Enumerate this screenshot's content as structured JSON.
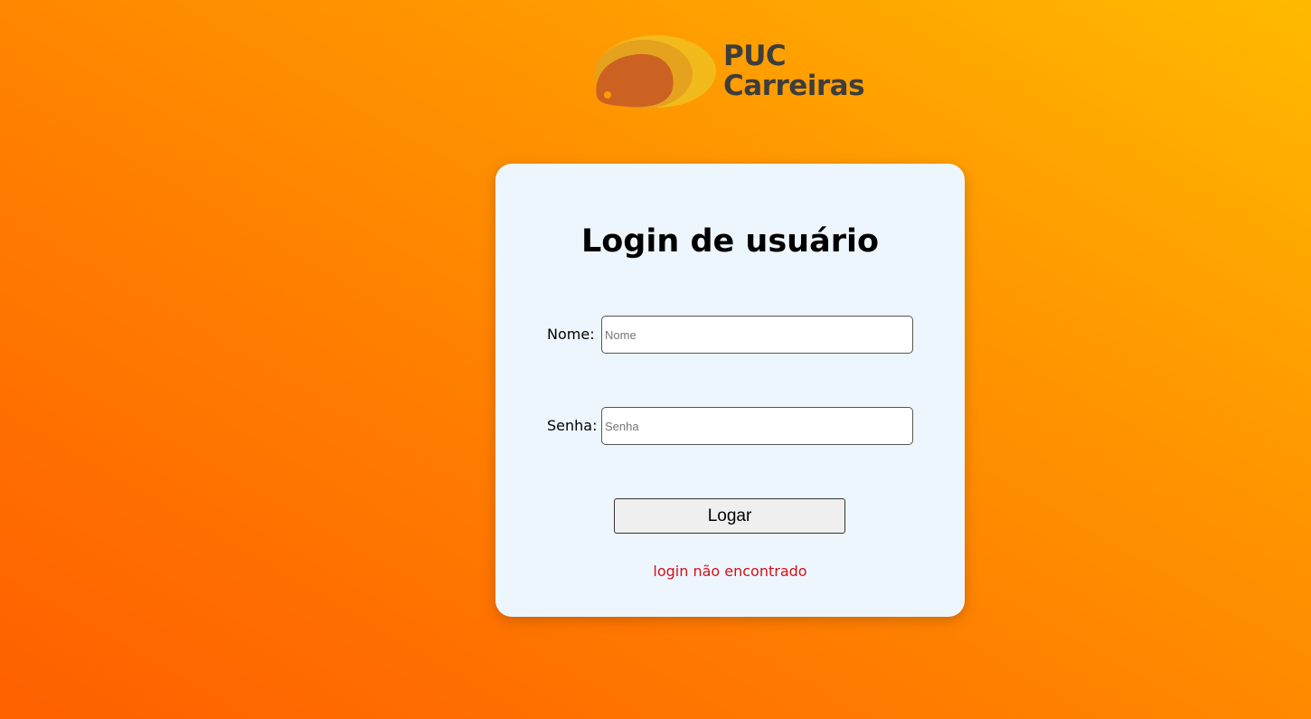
{
  "brand": {
    "logo_icon": "puc-blob-logo-icon",
    "line1": "PUC",
    "line2": "Carreiras"
  },
  "login": {
    "title": "Login de usuário",
    "name_label": "Nome:",
    "name_placeholder": "Nome",
    "name_value": "",
    "password_label": "Senha:",
    "password_placeholder": "Senha",
    "password_value": "",
    "button_label": "Logar",
    "error_message": "login não encontrado"
  },
  "colors": {
    "background_start": "#ff5f00",
    "background_end": "#ffba00",
    "card_background": "#eef6fd",
    "error_text": "#d0121b",
    "logo_text": "#3d3d3d"
  }
}
